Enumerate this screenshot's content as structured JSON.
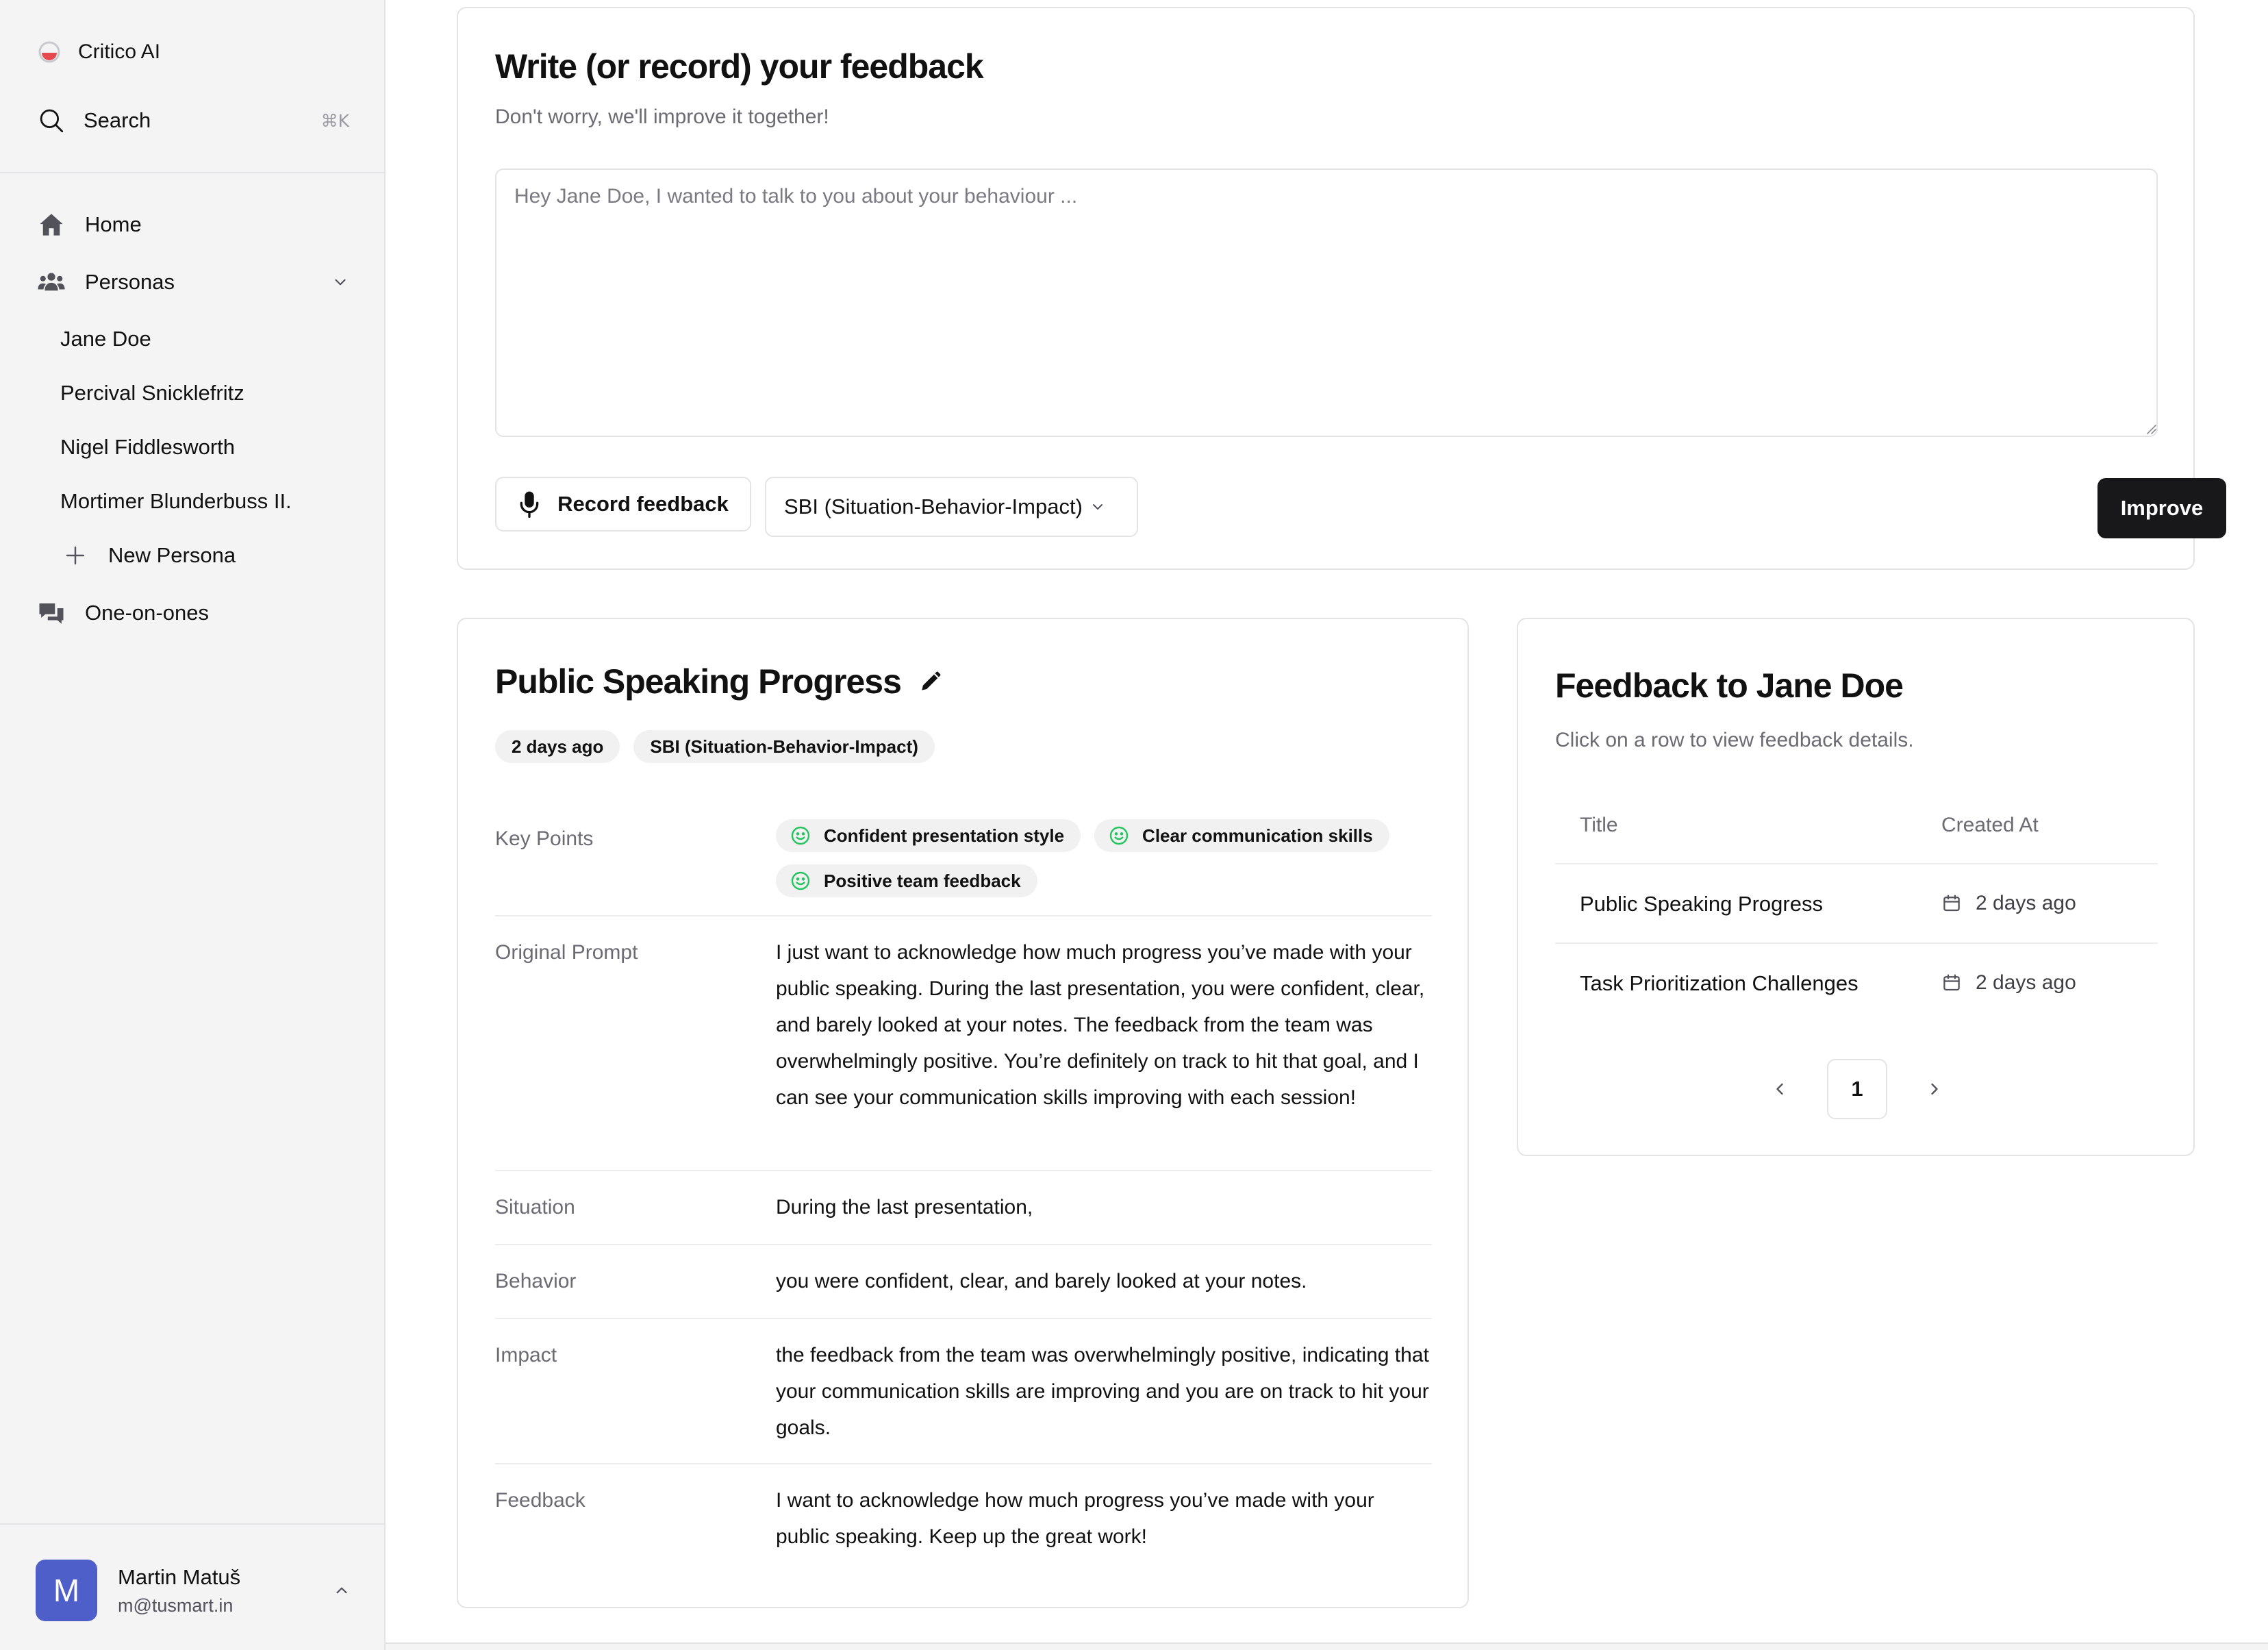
{
  "app": {
    "name": "Critico AI"
  },
  "sidebar": {
    "search_label": "Search",
    "search_shortcut": "⌘K",
    "nav": {
      "home": "Home",
      "personas": "Personas",
      "one_on_ones": "One-on-ones"
    },
    "personas": [
      "Jane Doe",
      "Percival Snicklefritz",
      "Nigel Fiddlesworth",
      "Mortimer Blunderbuss II."
    ],
    "new_persona": "New Persona",
    "user": {
      "initial": "M",
      "name": "Martin Matuš",
      "email": "m@tusmart.in"
    }
  },
  "compose": {
    "title": "Write (or record) your feedback",
    "subtitle": "Don't worry, we'll improve it together!",
    "placeholder": "Hey Jane Doe, I wanted to talk to you about your behaviour ...",
    "value": "",
    "record_label": "Record feedback",
    "framework_selected": "SBI (Situation-Behavior-Impact)",
    "improve_label": "Improve"
  },
  "detail": {
    "title": "Public Speaking Progress",
    "badges": [
      "2 days ago",
      "SBI (Situation-Behavior-Impact)"
    ],
    "key_points_label": "Key Points",
    "key_points": [
      "Confident presentation style",
      "Clear communication skills",
      "Positive team feedback"
    ],
    "rows": [
      {
        "label": "Original Prompt",
        "value": "I just want to acknowledge how much progress you’ve made with your public speaking. During the last presentation, you were confident, clear, and barely looked at your notes. The feedback from the team was overwhelmingly positive. You’re definitely on track to hit that goal, and I can see your communication skills improving with each session!"
      },
      {
        "label": "Situation",
        "value": "During the last presentation,"
      },
      {
        "label": "Behavior",
        "value": "you were confident, clear, and barely looked at your notes."
      },
      {
        "label": "Impact",
        "value": "the feedback from the team was overwhelmingly positive, indicating that your communication skills are improving and you are on track to hit your goals."
      },
      {
        "label": "Feedback",
        "value": "I want to acknowledge how much progress you’ve made with your public speaking. Keep up the great work!"
      }
    ]
  },
  "feedback_list": {
    "title": "Feedback to Jane Doe",
    "subtitle": "Click on a row to view feedback details.",
    "columns": [
      "Title",
      "Created At"
    ],
    "rows": [
      {
        "title": "Public Speaking Progress",
        "created": "2 days ago"
      },
      {
        "title": "Task Prioritization Challenges",
        "created": "2 days ago"
      }
    ],
    "page": "1"
  },
  "colors": {
    "accent_dark": "#18181b",
    "avatar": "#4f5fc9",
    "success": "#22c55e",
    "logo_red": "#e5484d"
  },
  "icons": [
    "logo-icon",
    "search-icon",
    "home-icon",
    "users-icon",
    "chevron-down-icon",
    "plus-icon",
    "chat-icon",
    "chevron-up-icon",
    "microphone-icon",
    "pencil-icon",
    "smile-icon",
    "calendar-icon",
    "chevron-left-icon",
    "chevron-right-icon"
  ]
}
